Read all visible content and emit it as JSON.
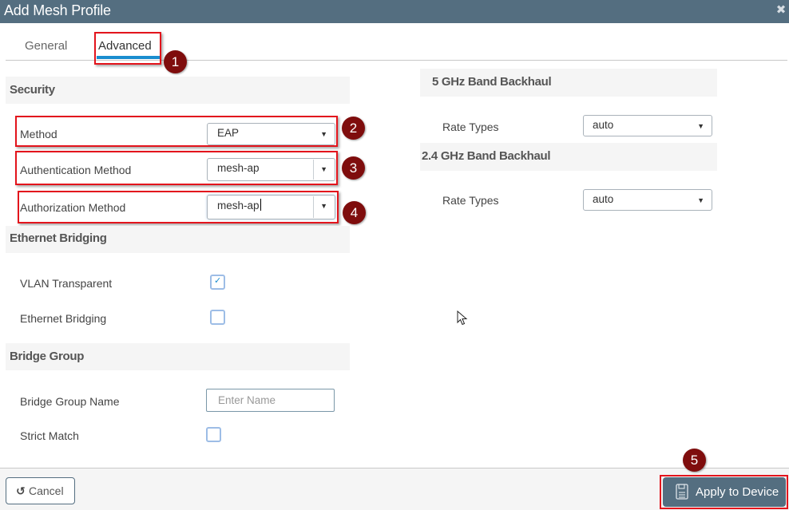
{
  "window": {
    "title": "Add Mesh Profile",
    "close_icon": "close-x-icon"
  },
  "tabs": [
    {
      "label": "General",
      "active": false
    },
    {
      "label": "Advanced",
      "active": true
    }
  ],
  "annotations": [
    "1",
    "2",
    "3",
    "4",
    "5"
  ],
  "security": {
    "heading": "Security",
    "method": {
      "label": "Method",
      "value": "EAP"
    },
    "authentication_method": {
      "label": "Authentication Method",
      "value": "mesh-ap"
    },
    "authorization_method": {
      "label": "Authorization Method",
      "value": "mesh-ap"
    }
  },
  "ethernet_bridging": {
    "heading": "Ethernet Bridging",
    "vlan_transparent": {
      "label": "VLAN Transparent",
      "checked": true
    },
    "ethernet_bridging": {
      "label": "Ethernet Bridging",
      "checked": false
    }
  },
  "bridge_group": {
    "heading": "Bridge Group",
    "name": {
      "label": "Bridge Group Name",
      "value": "",
      "placeholder": "Enter Name"
    },
    "strict_match": {
      "label": "Strict Match",
      "checked": false
    }
  },
  "band_5ghz": {
    "heading": "5 GHz Band Backhaul",
    "rate_types": {
      "label": "Rate Types",
      "value": "auto"
    }
  },
  "band_24ghz": {
    "heading": "2.4 GHz Band Backhaul",
    "rate_types": {
      "label": "Rate Types",
      "value": "auto"
    }
  },
  "footer": {
    "cancel_label": "Cancel",
    "apply_label": "Apply to Device"
  },
  "colors": {
    "header_bg": "#546e80",
    "tab_accent": "#1a8dcf",
    "annotation_red": "#e3141c",
    "badge_bg": "#7f0d0d"
  }
}
